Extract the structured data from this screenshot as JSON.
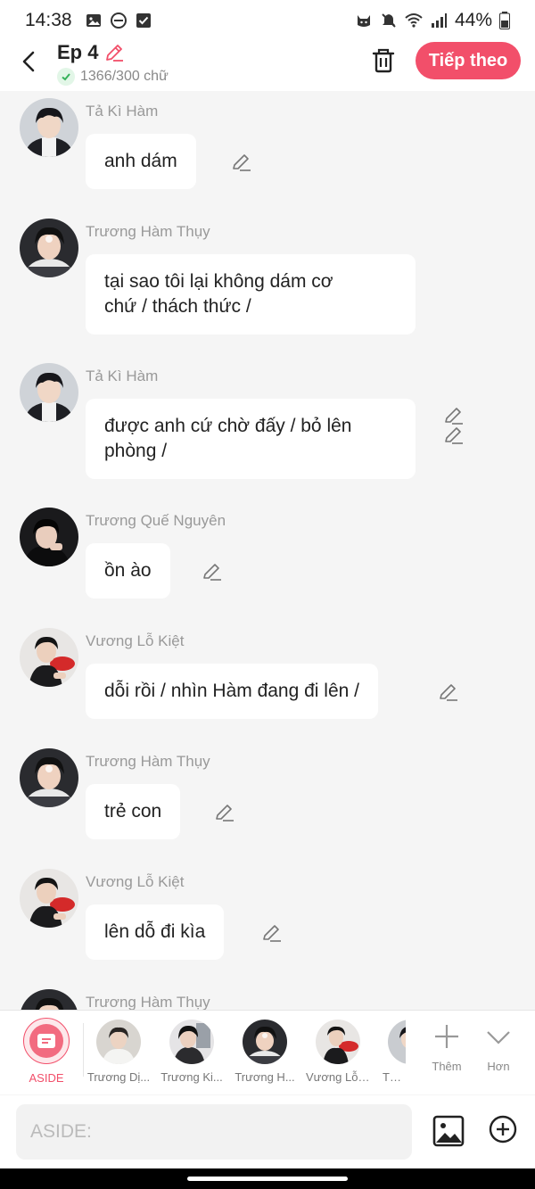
{
  "status_bar": {
    "time": "14:38",
    "battery": "44%",
    "icons_left": [
      "image-icon",
      "do-not-disturb-icon",
      "checkbox-icon"
    ],
    "icons_right": [
      "cat-icon",
      "mute-icon",
      "wifi-icon",
      "signal-icon",
      "battery-icon"
    ]
  },
  "header": {
    "title": "Ep 4",
    "word_count": "1366/300 chữ",
    "next_label": "Tiếp theo",
    "accent_color": "#f24f6a"
  },
  "messages": [
    {
      "name": "Tả Kì Hàm",
      "lines": [
        "anh dám"
      ],
      "avatar": "avatar-ta-ki-ham"
    },
    {
      "name": "Trương Hàm Thụy",
      "lines": [
        "tại sao tôi lại không dám cơ",
        "chứ / thách thức /"
      ],
      "avatar": "avatar-truong-ham-thuy"
    },
    {
      "name": "Tả Kì Hàm",
      "lines": [
        "được anh cứ chờ đấy / bỏ lên",
        "phòng /"
      ],
      "avatar": "avatar-ta-ki-ham"
    },
    {
      "name": "Trương Quế Nguyên",
      "lines": [
        "ồn ào"
      ],
      "avatar": "avatar-truong-que-nguyen"
    },
    {
      "name": "Vương Lỗ Kiệt",
      "lines": [
        "dỗi rồi / nhìn Hàm đang đi lên /"
      ],
      "avatar": "avatar-vuong-lo-kiet"
    },
    {
      "name": "Trương Hàm Thụy",
      "lines": [
        "trẻ con"
      ],
      "avatar": "avatar-truong-ham-thuy"
    },
    {
      "name": "Vương Lỗ Kiệt",
      "lines": [
        "lên dỗ đi kìa"
      ],
      "avatar": "avatar-vuong-lo-kiet"
    },
    {
      "name": "Trương Hàm Thụy",
      "lines": [
        ""
      ],
      "avatar": "avatar-truong-ham-thuy"
    }
  ],
  "toolbar": {
    "aside_label": "ASIDE",
    "characters": [
      "Trương Dị...",
      "Trương Ki...",
      "Trương H...",
      "Vương Lỗ ...",
      "Tả K"
    ],
    "more_label": "Thêm",
    "expand_label": "Hơn"
  },
  "input": {
    "placeholder": "ASIDE:"
  }
}
